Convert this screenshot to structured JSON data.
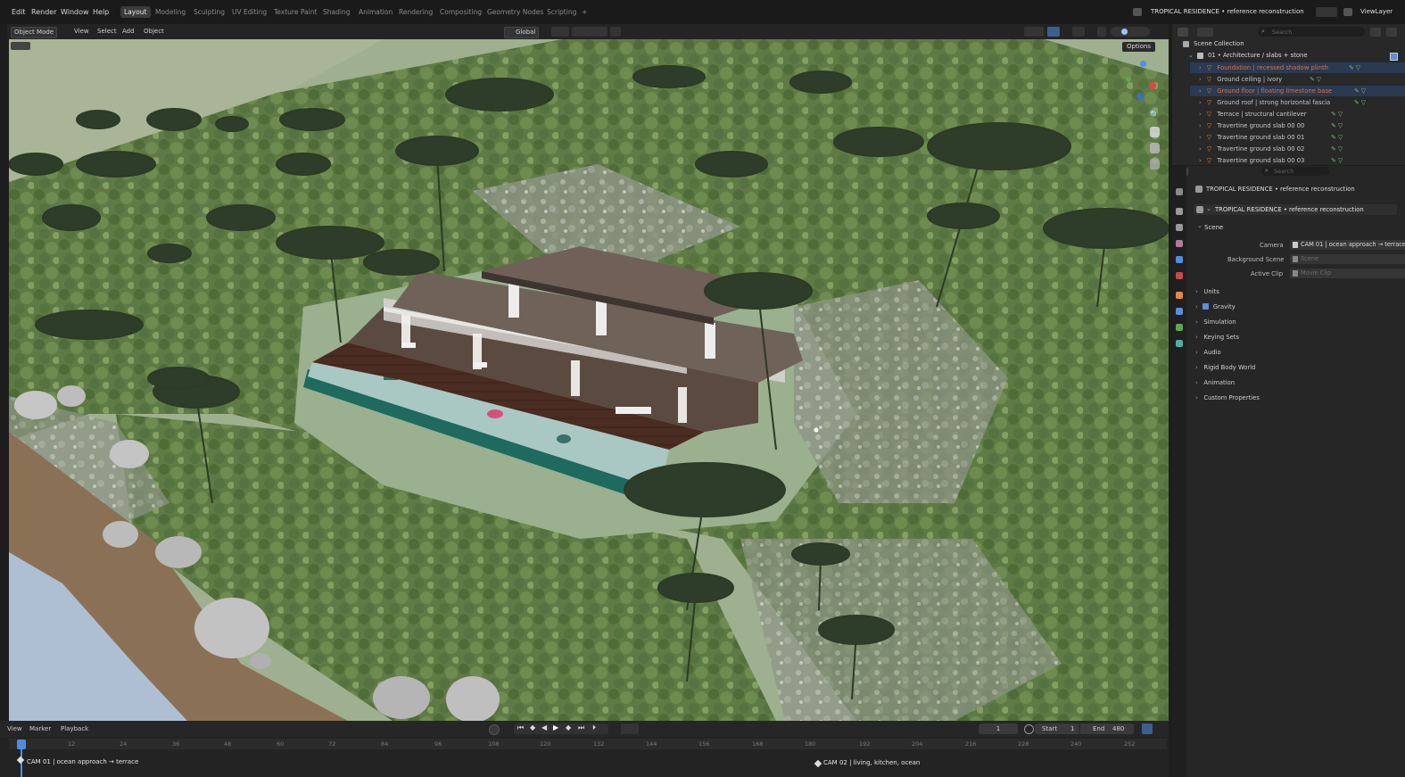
{
  "menu": [
    "Edit",
    "Render",
    "Window",
    "Help"
  ],
  "workspace_tabs": [
    "Layout",
    "Modeling",
    "Sculpting",
    "UV Editing",
    "Texture Paint",
    "Shading",
    "Animation",
    "Rendering",
    "Compositing",
    "Geometry Nodes",
    "Scripting"
  ],
  "add_workspace": "+",
  "scene_name": "TROPICAL RESIDENCE • reference reconstruction",
  "view_layer": "ViewLayer",
  "viewport_header": {
    "mode": "Object Mode",
    "items": [
      "View",
      "Select",
      "Add",
      "Object"
    ],
    "orientation": "Global",
    "options": "Options"
  },
  "outliner": {
    "search_placeholder": "Search",
    "title": "Scene Collection",
    "collection": "01 • Architecture / slabs + stone",
    "rows": [
      {
        "label": "Foundation | recessed shadow plinth"
      },
      {
        "label": "Ground ceiling | ivory"
      },
      {
        "label": "Ground floor | floating limestone base"
      },
      {
        "label": "Ground roof | strong horizontal fascia"
      },
      {
        "label": "Terrace | structural cantilever"
      },
      {
        "label": "Travertine ground slab 00 00"
      },
      {
        "label": "Travertine ground slab 00 01"
      },
      {
        "label": "Travertine ground slab 00 02"
      },
      {
        "label": "Travertine ground slab 00 03"
      }
    ]
  },
  "properties": {
    "search_placeholder": "Search",
    "scene_line": "TROPICAL RESIDENCE • reference reconstruction",
    "scene_field": "TROPICAL RESIDENCE • reference reconstruction",
    "panel_title": "Scene",
    "camera_label": "Camera",
    "camera_value": "CAM 01 | ocean approach → terrace",
    "background_label": "Background Scene",
    "background_placeholder": "Scene",
    "clip_label": "Active Clip",
    "clip_placeholder": "Movie Clip",
    "sections": [
      "Units",
      "Gravity",
      "Simulation",
      "Keying Sets",
      "Audio",
      "Rigid Body World",
      "Animation",
      "Custom Properties"
    ]
  },
  "timeline": {
    "menus": [
      "View",
      "Marker",
      "Playback"
    ],
    "current_frame": "1",
    "start_label": "Start",
    "start_value": "1",
    "end_label": "End",
    "end_value": "480",
    "ruler": [
      "1",
      "12",
      "24",
      "36",
      "48",
      "60",
      "72",
      "84",
      "96",
      "108",
      "120",
      "132",
      "144",
      "156",
      "168",
      "180",
      "192",
      "204",
      "216",
      "228",
      "240",
      "252"
    ],
    "markers": [
      "CAM 01 | ocean approach → terrace",
      "CAM 02 | living, kitchen, ocean"
    ]
  },
  "colors": {
    "accent": "#4a90e2",
    "selection": "#2a3a52",
    "orange": "#e0703a"
  }
}
